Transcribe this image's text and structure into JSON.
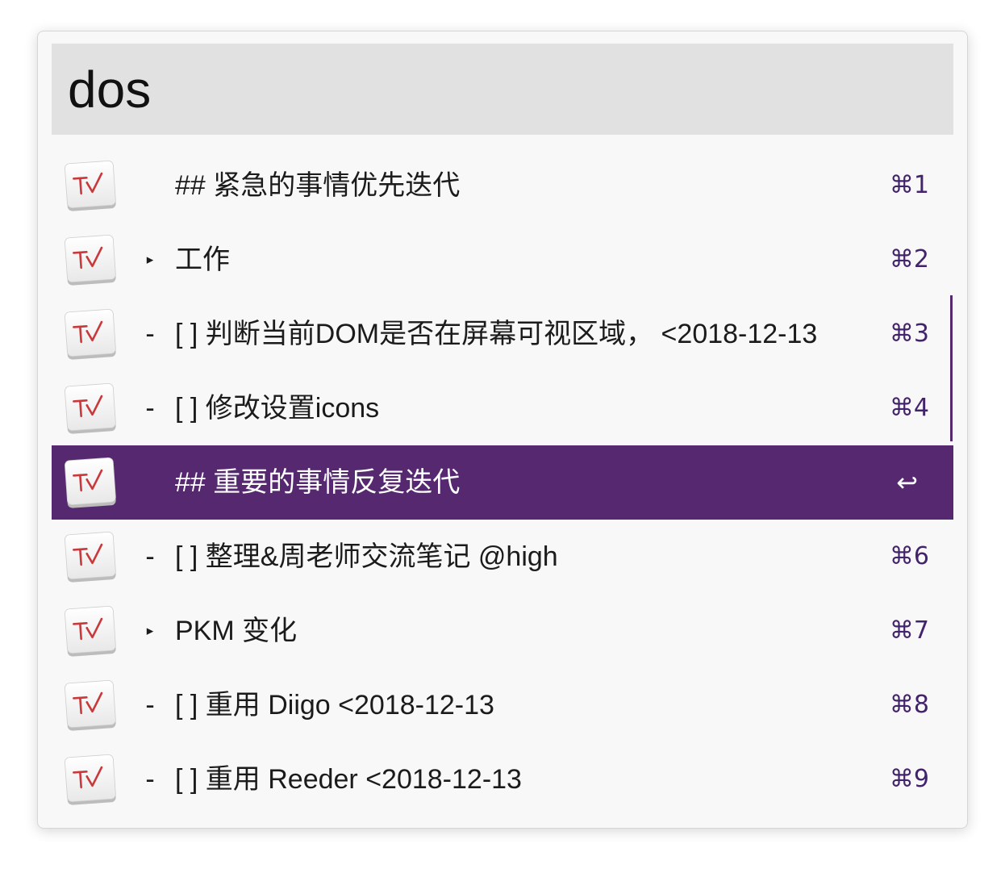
{
  "search": {
    "query": "dos"
  },
  "results": [
    {
      "prefix": "",
      "title": "## 紧急的事情优先迭代",
      "shortcut": "⌘1",
      "selected": false
    },
    {
      "prefix": "▸",
      "title": "工作",
      "shortcut": "⌘2",
      "selected": false
    },
    {
      "prefix": "-",
      "title": "[ ] 判断当前DOM是否在屏幕可视区域， <2018-12-13",
      "shortcut": "⌘3",
      "selected": false
    },
    {
      "prefix": "-",
      "title": "[ ] 修改设置icons",
      "shortcut": "⌘4",
      "selected": false
    },
    {
      "prefix": "",
      "title": "## 重要的事情反复迭代",
      "shortcut": "↩",
      "selected": true
    },
    {
      "prefix": "-",
      "title": "[ ] 整理&周老师交流笔记 @high",
      "shortcut": "⌘6",
      "selected": false
    },
    {
      "prefix": "▸",
      "title": "PKM 变化",
      "shortcut": "⌘7",
      "selected": false
    },
    {
      "prefix": "-",
      "title": "[ ] 重用 Diigo <2018-12-13",
      "shortcut": "⌘8",
      "selected": false
    },
    {
      "prefix": "-",
      "title": "[ ] 重用 Reeder <2018-12-13",
      "shortcut": "⌘9",
      "selected": false
    }
  ],
  "icons": {
    "result_icon": "taskpaper-app-icon",
    "disclosure": "disclosure-triangle-icon",
    "return": "return-key-icon"
  },
  "colors": {
    "selection": "#55286f",
    "shortcut": "#43236b",
    "search_background": "#e1e1e1"
  }
}
